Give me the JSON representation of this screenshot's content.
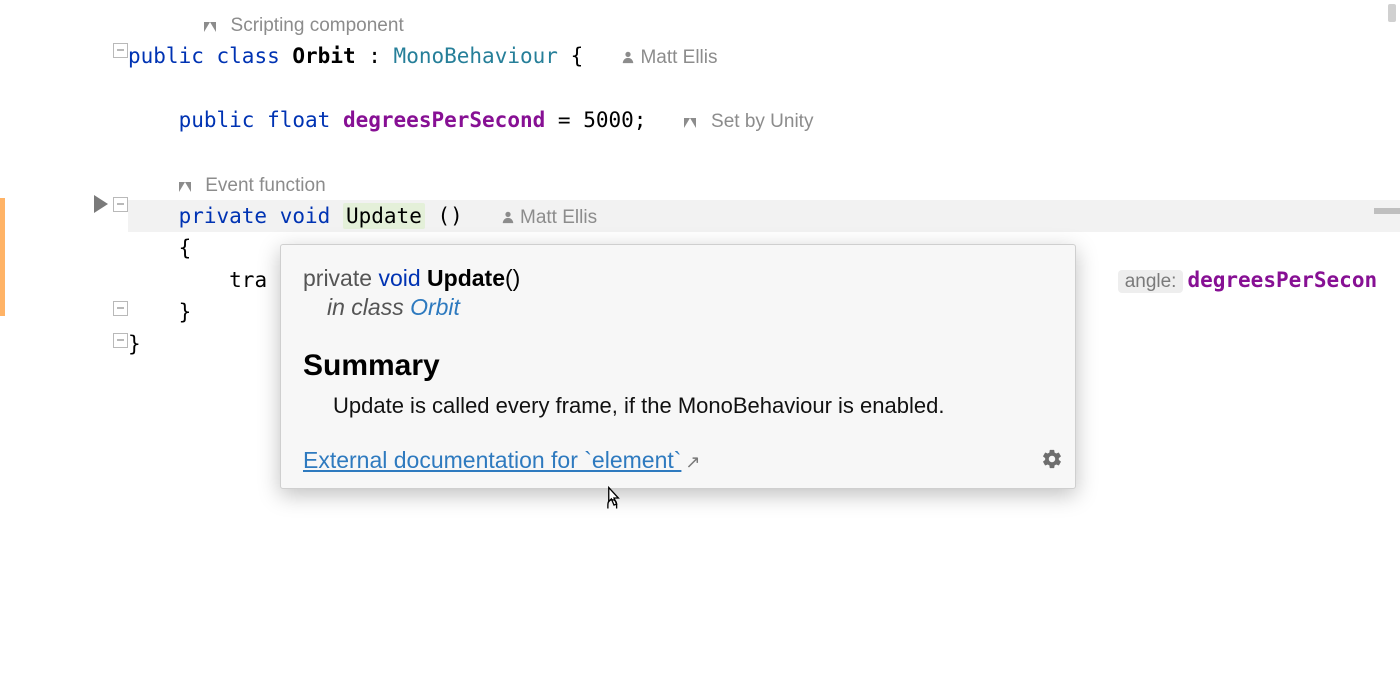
{
  "inlays": {
    "scripting_component": "Scripting component",
    "event_function": "Event function",
    "set_by_unity": "Set by Unity",
    "author1": "Matt Ellis",
    "author2": "Matt Ellis"
  },
  "code": {
    "public": "public",
    "class": "class",
    "classname": "Orbit",
    "colon": " : ",
    "basetype": "MonoBehaviour",
    "lbrace": " {",
    "fieldline_public": "public",
    "fieldline_type": "float",
    "fieldline_name": "degreesPerSecond",
    "fieldline_rest": " = 5000;",
    "private": "private",
    "void": "void",
    "update": "Update",
    "parens": " ()",
    "body_lbrace": "{",
    "body_frag": "tra",
    "after_popup_comma": ",",
    "angle_hint": "angle:",
    "degrees_ref": "degreesPerSecon",
    "body_rbrace": "}",
    "close_brace": "}"
  },
  "popup": {
    "sig_private": "private",
    "sig_void": "void",
    "sig_name": "Update",
    "sig_parens": "()",
    "in_class": "in class",
    "class_ref": "Orbit",
    "summary_h": "Summary",
    "summary_body": "Update is called every frame, if the MonoBehaviour is enabled.",
    "link": "External documentation for `element`",
    "ext_arrow": "↗"
  }
}
